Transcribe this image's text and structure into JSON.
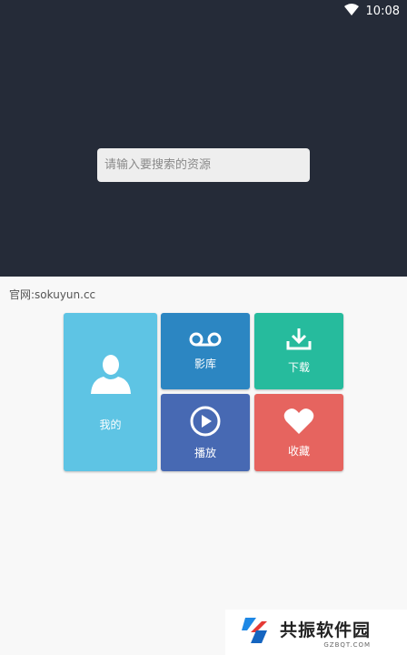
{
  "status_bar": {
    "time": "10:08",
    "wifi_icon": "wifi-icon"
  },
  "search": {
    "placeholder": "请输入要搜索的资源"
  },
  "site_label": "官网:sokuyun.cc",
  "tiles": {
    "me": {
      "label": "我的",
      "icon": "user-icon",
      "color": "#5ec4e4"
    },
    "library": {
      "label": "影库",
      "icon": "voicemail-icon",
      "color": "#2c86c2"
    },
    "download": {
      "label": "下载",
      "icon": "download-icon",
      "color": "#26bb9d"
    },
    "play": {
      "label": "播放",
      "icon": "play-circle-icon",
      "color": "#4769b3"
    },
    "favorites": {
      "label": "收藏",
      "icon": "heart-icon",
      "color": "#e6645f"
    }
  },
  "watermark": {
    "name": "共振软件园",
    "url": "GZBQT.COM"
  },
  "colors": {
    "header_bg": "#252b38",
    "body_bg": "#f8f8f8"
  }
}
